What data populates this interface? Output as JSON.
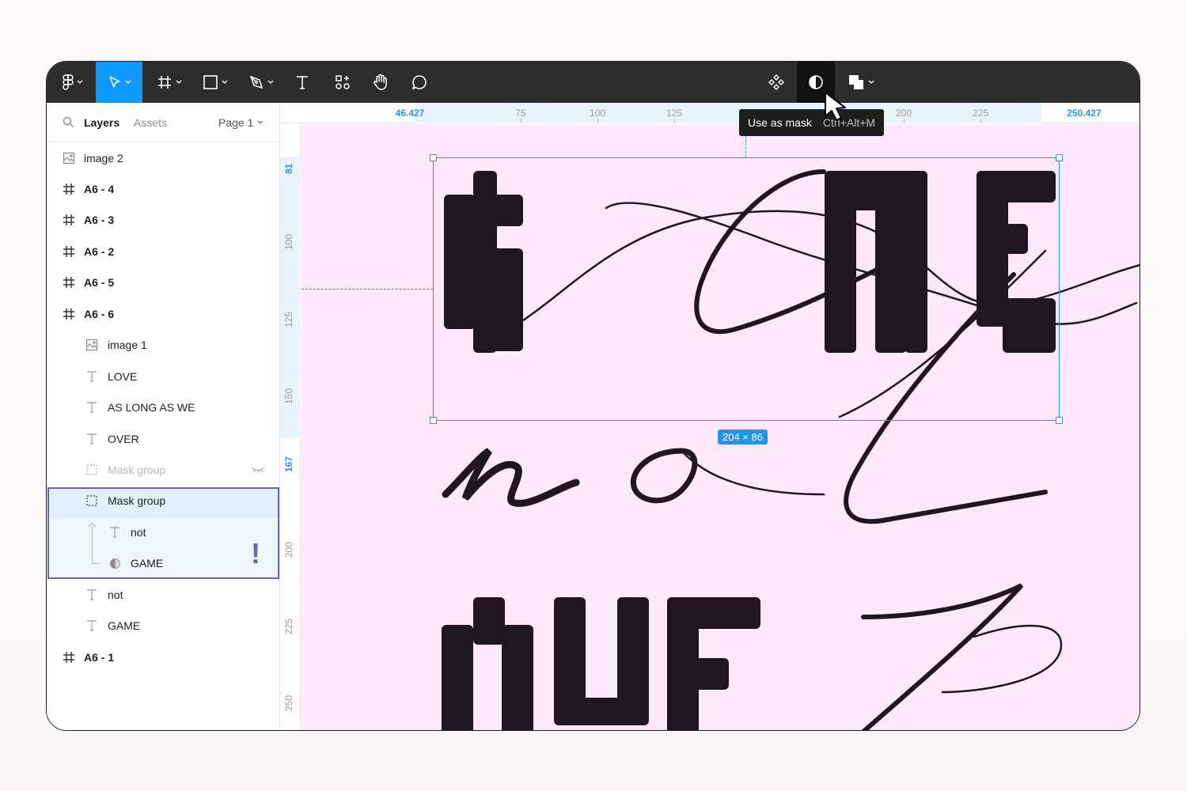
{
  "toolbar": {
    "tools": [
      {
        "name": "main-menu",
        "icon": "figma-logo-icon",
        "has_dropdown": true
      },
      {
        "name": "move",
        "icon": "move-cursor-icon",
        "has_dropdown": true,
        "active": true
      },
      {
        "name": "frame",
        "icon": "frame-hash-icon",
        "has_dropdown": true
      },
      {
        "name": "shape",
        "icon": "rectangle-icon",
        "has_dropdown": true
      },
      {
        "name": "pen",
        "icon": "pen-icon",
        "has_dropdown": true
      },
      {
        "name": "text",
        "icon": "text-icon"
      },
      {
        "name": "resources",
        "icon": "resources-icon"
      },
      {
        "name": "hand",
        "icon": "hand-icon"
      },
      {
        "name": "comment",
        "icon": "comment-icon"
      }
    ],
    "center_tools": [
      {
        "name": "component",
        "icon": "component-icon"
      },
      {
        "name": "mask",
        "icon": "mask-icon",
        "hovered": true
      },
      {
        "name": "boolean",
        "icon": "boolean-icon",
        "has_dropdown": true
      }
    ],
    "accent_color": "#0d99ff",
    "background_color": "#2c2c2c"
  },
  "tooltip": {
    "label": "Use as mask",
    "shortcut": "Ctrl+Alt+M"
  },
  "panel": {
    "tab_layers": "Layers",
    "tab_assets": "Assets",
    "page": "Page 1",
    "layers": [
      {
        "label": "image 2",
        "type": "image"
      },
      {
        "label": "A6 - 4",
        "type": "frame"
      },
      {
        "label": "A6 - 3",
        "type": "frame"
      },
      {
        "label": "A6 - 2",
        "type": "frame"
      },
      {
        "label": "A6 - 5",
        "type": "frame"
      },
      {
        "label": "A6 - 6",
        "type": "frame"
      },
      {
        "label": "image 1",
        "type": "image"
      },
      {
        "label": "LOVE",
        "type": "text"
      },
      {
        "label": "AS LONG AS WE",
        "type": "text"
      },
      {
        "label": "OVER",
        "type": "text"
      },
      {
        "label": "Mask group",
        "type": "mask-group",
        "hidden": true
      },
      {
        "label": "Mask group",
        "type": "mask-group",
        "selected": true
      },
      {
        "label": "not",
        "type": "text"
      },
      {
        "label": "GAME",
        "type": "mask"
      },
      {
        "label": "not",
        "type": "text"
      },
      {
        "label": "GAME",
        "type": "text"
      },
      {
        "label": "A6 - 1",
        "type": "frame"
      }
    ],
    "warning_mark": "!"
  },
  "ruler_top": {
    "start_value": "46.427",
    "ticks": [
      "75",
      "100",
      "125",
      "200",
      "225"
    ],
    "end_value": "250.427"
  },
  "ruler_left": {
    "start_value": "81",
    "ticks": [
      "100",
      "125",
      "150",
      "200",
      "225",
      "250"
    ],
    "end_value": "167"
  },
  "canvas": {
    "background_color": "#fde9fb",
    "selection_color": "#2f92f0",
    "selection_size": "204 × 86"
  }
}
